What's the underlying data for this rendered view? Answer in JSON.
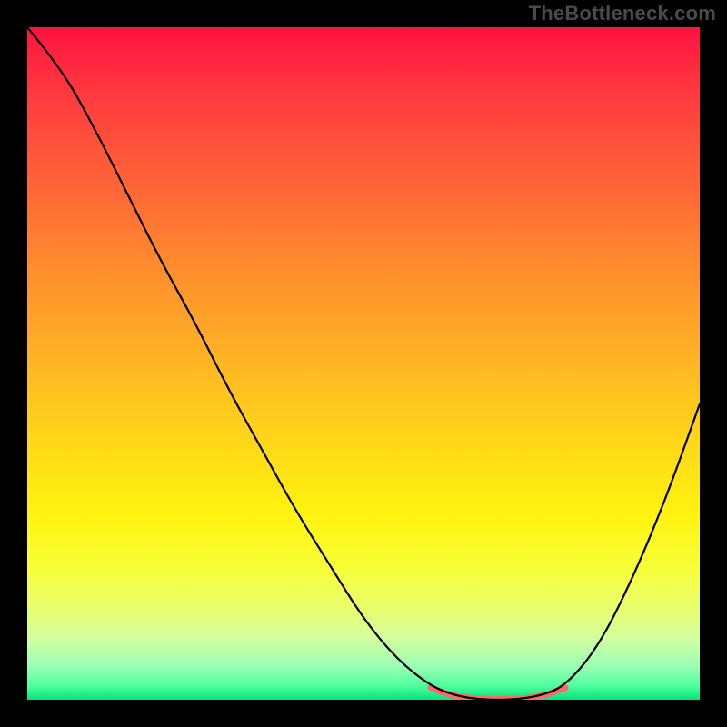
{
  "watermark": {
    "text": "TheBottleneck.com"
  },
  "gradient": {
    "stops": [
      {
        "pct": 0,
        "color": "#ff1240"
      },
      {
        "pct": 10,
        "color": "#ff3a3f"
      },
      {
        "pct": 22,
        "color": "#ff6038"
      },
      {
        "pct": 35,
        "color": "#ff8a2e"
      },
      {
        "pct": 48,
        "color": "#ffb025"
      },
      {
        "pct": 60,
        "color": "#ffd31a"
      },
      {
        "pct": 72,
        "color": "#fff20f"
      },
      {
        "pct": 80,
        "color": "#f8ff35"
      },
      {
        "pct": 86,
        "color": "#eaff6a"
      },
      {
        "pct": 91,
        "color": "#d2ffa0"
      },
      {
        "pct": 95,
        "color": "#9bffb5"
      },
      {
        "pct": 98,
        "color": "#4dff9d"
      },
      {
        "pct": 100,
        "color": "#00e57a"
      }
    ]
  },
  "chart_data": {
    "type": "line",
    "title": "",
    "xlabel": "",
    "ylabel": "",
    "axes_visible": false,
    "grid": false,
    "background": "red-to-green vertical gradient",
    "series": [
      {
        "name": "curve",
        "color": "#000000",
        "stroke_width": 2,
        "x": [
          0.0,
          0.05,
          0.1,
          0.15,
          0.2,
          0.25,
          0.3,
          0.35,
          0.4,
          0.45,
          0.5,
          0.55,
          0.6,
          0.64,
          0.68,
          0.72,
          0.76,
          0.8,
          0.85,
          0.9,
          0.95,
          1.0
        ],
        "y": [
          1.0,
          0.94,
          0.85,
          0.75,
          0.65,
          0.56,
          0.46,
          0.37,
          0.28,
          0.2,
          0.12,
          0.06,
          0.02,
          0.005,
          0.0,
          0.0,
          0.005,
          0.02,
          0.08,
          0.18,
          0.3,
          0.44
        ]
      },
      {
        "name": "bottom-highlight",
        "color": "#ff6a6e",
        "stroke_width": 6,
        "x": [
          0.6,
          0.62,
          0.64,
          0.66,
          0.68,
          0.7,
          0.72,
          0.74,
          0.76,
          0.78,
          0.8
        ],
        "y": [
          0.018,
          0.01,
          0.005,
          0.002,
          0.001,
          0.001,
          0.001,
          0.002,
          0.005,
          0.01,
          0.018
        ]
      }
    ],
    "xlim": [
      0,
      1
    ],
    "ylim": [
      0,
      1
    ]
  }
}
